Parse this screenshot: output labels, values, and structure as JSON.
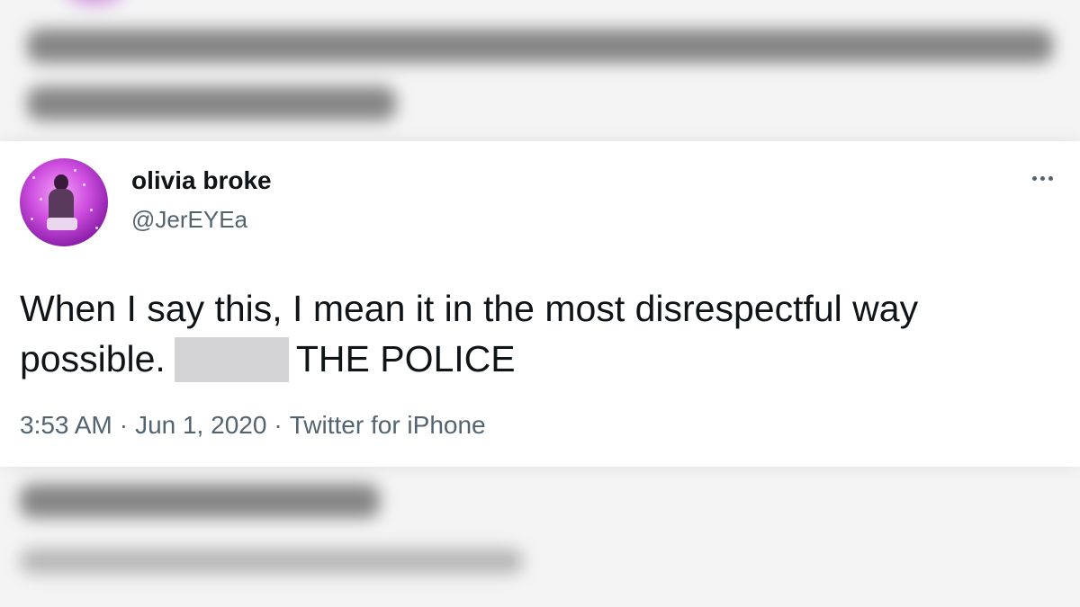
{
  "tweet": {
    "display_name": "olivia broke",
    "handle": "@JerEYEa",
    "text_line1": "When I say this, I mean it in the most disrespectful way",
    "text_line2_start": "possible.",
    "text_line2_end": "THE POLICE",
    "time": "3:53 AM",
    "separator": "·",
    "date": "Jun 1, 2020",
    "source": "Twitter for iPhone",
    "avatar_icon": "profile-photo-icon",
    "more_icon": "more-options-icon"
  },
  "colors": {
    "text_primary": "#0f1419",
    "text_secondary": "#536471",
    "redaction": "#d4d4d6",
    "avatar_accent": "#cf4fe0"
  }
}
